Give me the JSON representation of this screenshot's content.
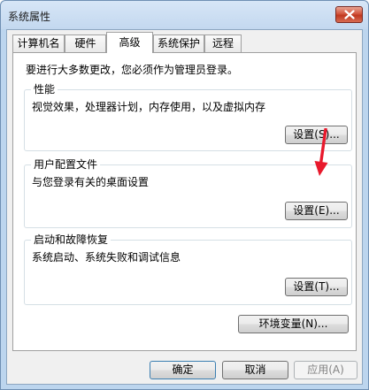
{
  "window": {
    "title": "系统属性"
  },
  "tabs": [
    {
      "label": "计算机名"
    },
    {
      "label": "硬件"
    },
    {
      "label": "高级"
    },
    {
      "label": "系统保护"
    },
    {
      "label": "远程"
    }
  ],
  "active_tab": "高级",
  "panel": {
    "admin_note": "要进行大多数更改，您必须作为管理员登录。",
    "performance": {
      "title": "性能",
      "description": "视觉效果，处理器计划，内存使用，以及虚拟内存",
      "button": "设置(S)..."
    },
    "user_profiles": {
      "title": "用户配置文件",
      "description": "与您登录有关的桌面设置",
      "button": "设置(E)..."
    },
    "startup_recovery": {
      "title": "启动和故障恢复",
      "description": "系统启动、系统失败和调试信息",
      "button": "设置(T)..."
    },
    "env_button": "环境变量(N)..."
  },
  "buttons": {
    "ok": "确定",
    "cancel": "取消",
    "apply": "应用(A)"
  },
  "colors": {
    "annotation_arrow": "#e8192c",
    "close_button": "#c7462e",
    "frame": "#bcd5ee"
  },
  "icons": {
    "close": "close-icon",
    "annotation": "red-arrow-annotation"
  }
}
